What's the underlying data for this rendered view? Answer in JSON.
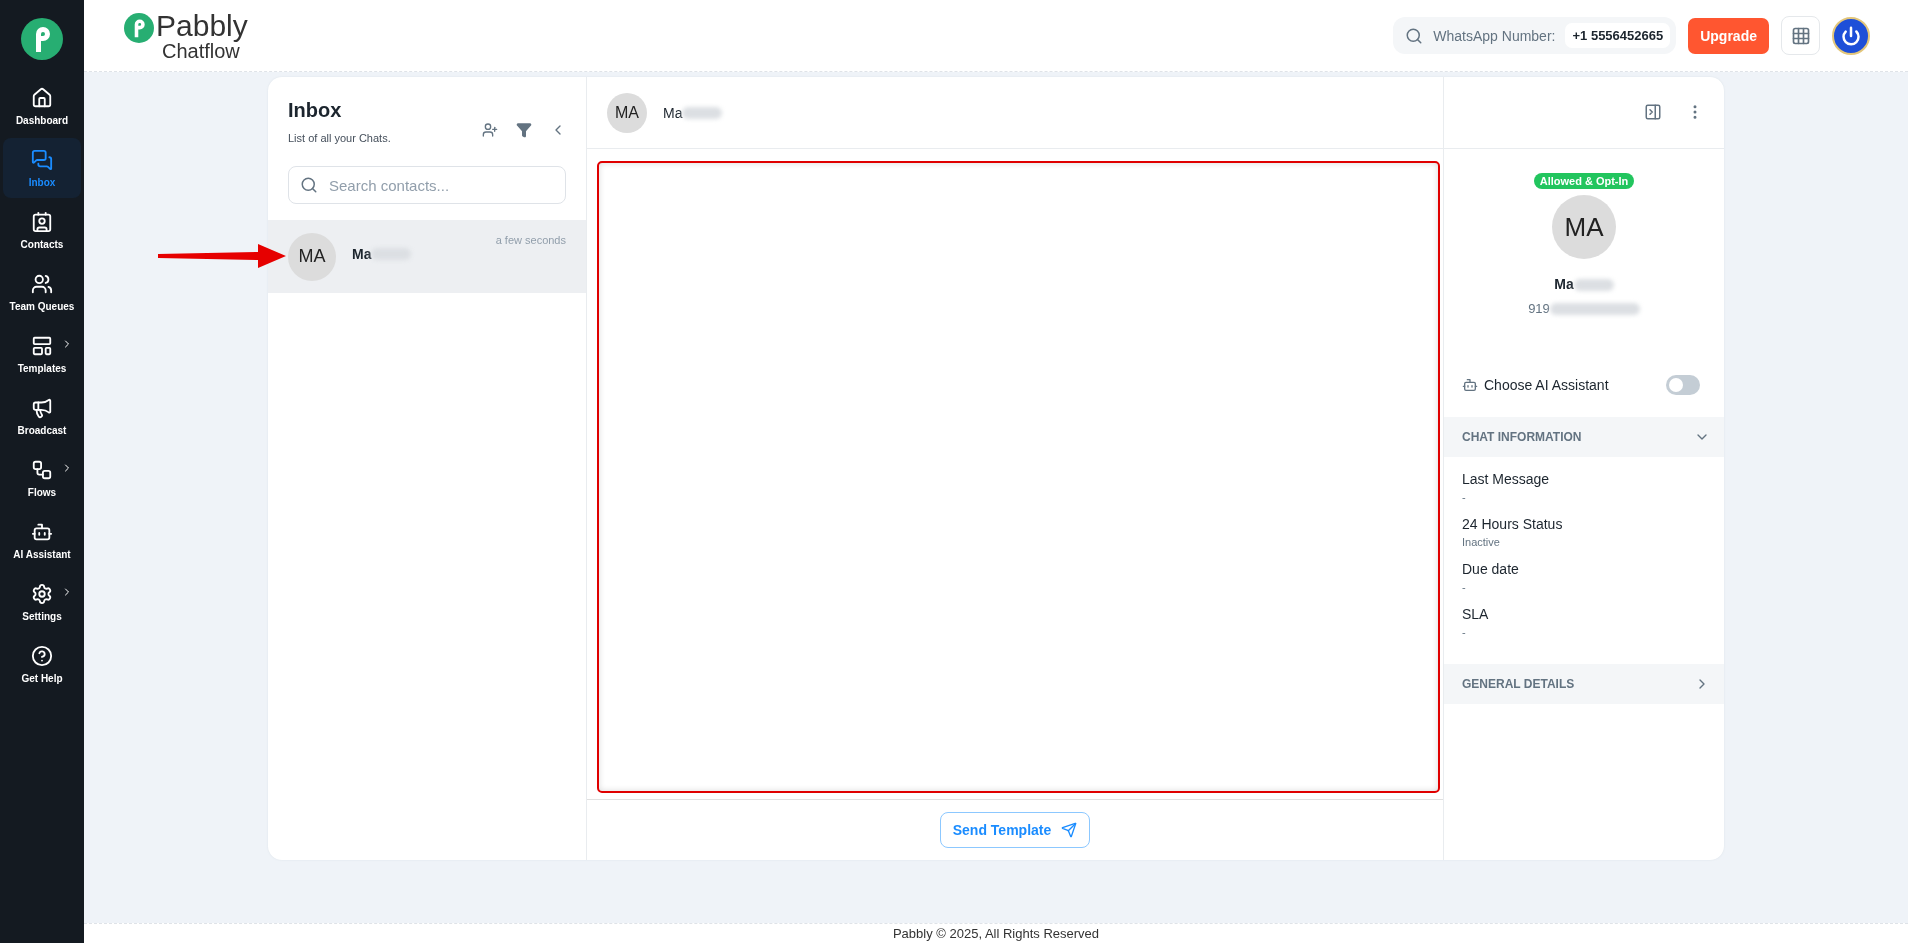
{
  "sidebar": {
    "items": [
      {
        "label": "Dashboard",
        "selected": false,
        "has_submenu": false
      },
      {
        "label": "Inbox",
        "selected": true,
        "has_submenu": false
      },
      {
        "label": "Contacts",
        "selected": false,
        "has_submenu": false
      },
      {
        "label": "Team Queues",
        "selected": false,
        "has_submenu": false
      },
      {
        "label": "Templates",
        "selected": false,
        "has_submenu": true
      },
      {
        "label": "Broadcast",
        "selected": false,
        "has_submenu": false
      },
      {
        "label": "Flows",
        "selected": false,
        "has_submenu": true
      },
      {
        "label": "AI Assistant",
        "selected": false,
        "has_submenu": false
      },
      {
        "label": "Settings",
        "selected": false,
        "has_submenu": true
      },
      {
        "label": "Get Help",
        "selected": false,
        "has_submenu": false
      }
    ]
  },
  "header": {
    "brand": "Pabbly",
    "product": "Chatflow",
    "whatsapp_label": "WhatsApp Number:",
    "whatsapp_number": "+1 5556452665",
    "upgrade": "Upgrade"
  },
  "inbox": {
    "title": "Inbox",
    "subtitle": "List of all your Chats.",
    "search_placeholder": "Search contacts...",
    "chats": [
      {
        "initials": "MA",
        "name": "Ma",
        "time": "a few seconds",
        "selected": true
      }
    ]
  },
  "chat": {
    "initials": "MA",
    "name": "Ma",
    "send_template": "Send Template"
  },
  "contact": {
    "badge": "Allowed & Opt-In",
    "initials": "MA",
    "name": "Ma",
    "phone": "919",
    "ai_label": "Choose AI Assistant",
    "ai_on": false,
    "sections": [
      {
        "title": "CHAT INFORMATION",
        "expanded": true,
        "fields": [
          {
            "label": "Last Message",
            "value": "-"
          },
          {
            "label": "24 Hours Status",
            "value": "Inactive"
          },
          {
            "label": "Due date",
            "value": "-"
          },
          {
            "label": "SLA",
            "value": "-"
          }
        ]
      },
      {
        "title": "GENERAL DETAILS",
        "expanded": false
      }
    ]
  },
  "footer": "Pabbly © 2025, All Rights Reserved"
}
